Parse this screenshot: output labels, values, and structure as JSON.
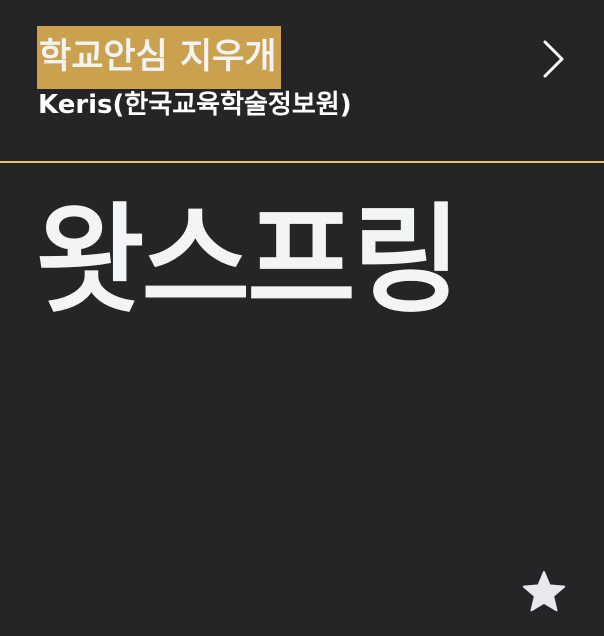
{
  "header": {
    "app_title": "학교안심 지우개",
    "publisher": "Keris(한국교육학술정보원)",
    "next_icon": "chevron-right-icon"
  },
  "word_card": {
    "word": "왓스프링"
  },
  "favorite": {
    "icon": "star-icon"
  },
  "colors": {
    "background": "#252528",
    "title_highlight": "#c9a14f",
    "divider": "#e9c46a",
    "word_text": "#f3f4f6",
    "star": "#e8e9ed"
  }
}
